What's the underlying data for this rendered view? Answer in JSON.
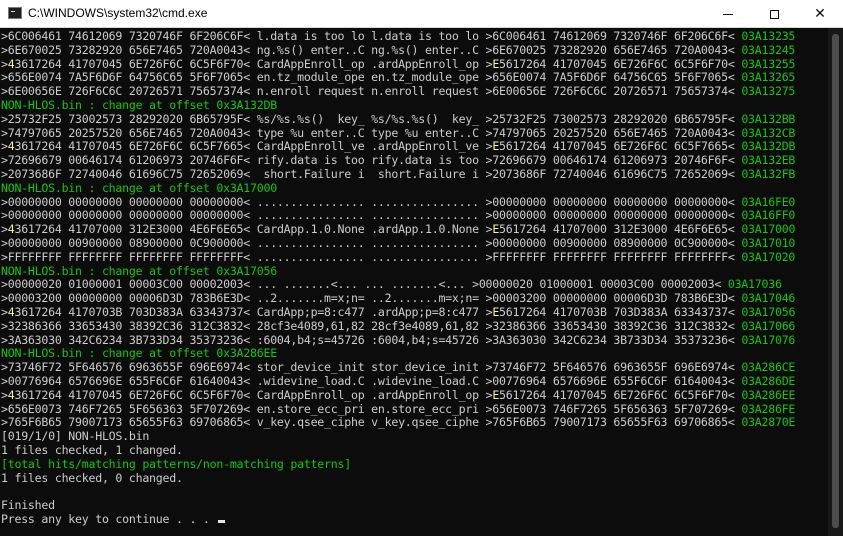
{
  "window": {
    "title": "C:\\WINDOWS\\system32\\cmd.exe",
    "icon": "cmd-icon",
    "controls": [
      "minimize-icon",
      "maximize-icon",
      "close-icon"
    ]
  },
  "colors": {
    "background": "#0c0c0c",
    "text": "#cccccc",
    "accent": "#16c60c",
    "highlight": "#f9f1a5"
  },
  "console": {
    "lines": [
      {
        "color": "gray",
        "text": ">6C006461 74612069 7320746F 6F206C6F< l.data is too lo l.data is too lo >6C006461 74612069 7320746F 6F206C6F< ",
        "addr": "03A13235"
      },
      {
        "color": "gray",
        "text": ">6E670025 73282920 656E7465 720A0043< ng.%s() enter..C ng.%s() enter..C >6E670025 73282920 656E7465 720A0043< ",
        "addr": "03A13245"
      },
      {
        "color": "gray",
        "pre": ">",
        "hl": "4",
        "text": "3617264 41707045 6E726F6C 6C5F6F70< CardAppEnroll_op .ardAppEnroll_op >",
        "hl2": "E",
        "post": "5617264 41707045 6E726F6C 6C5F6F70< ",
        "addr": "03A13255"
      },
      {
        "color": "gray",
        "text": ">656E0074 7A5F6D6F 64756C65 5F6F7065< en.tz_module_ope en.tz_module_ope >656E0074 7A5F6D6F 64756C65 5F6F7065< ",
        "addr": "03A13265"
      },
      {
        "color": "gray",
        "text": ">6E00656E 726F6C6C 20726571 75657374< n.enroll request n.enroll request >6E00656E 726F6C6C 20726571 75657374< ",
        "addr": "03A13275"
      },
      {
        "color": "green",
        "text": "NON-HLOS.bin : change at offset 0x3A132DB"
      },
      {
        "color": "gray",
        "text": ">25732F25 73002573 28292020 6B65795F< %s/%s.%s()  key_ %s/%s.%s()  key_ >25732F25 73002573 28292020 6B65795F< ",
        "addr": "03A132BB"
      },
      {
        "color": "gray",
        "text": ">74797065 20257520 656E7465 720A0043< type %u enter..C type %u enter..C >74797065 20257520 656E7465 720A0043< ",
        "addr": "03A132CB"
      },
      {
        "color": "gray",
        "pre": ">",
        "hl": "4",
        "text": "3617264 41707045 6E726F6C 6C5F7665< CardAppEnroll_ve .ardAppEnroll_ve >",
        "hl2": "E",
        "post": "5617264 41707045 6E726F6C 6C5F7665< ",
        "addr": "03A132DB"
      },
      {
        "color": "gray",
        "text": ">72696679 00646174 61206973 20746F6F< rify.data is too rify.data is too >72696679 00646174 61206973 20746F6F< ",
        "addr": "03A132EB"
      },
      {
        "color": "gray",
        "text": ">2073686F 72740046 61696C75 72652069<  short.Failure i  short.Failure i >2073686F 72740046 61696C75 72652069< ",
        "addr": "03A132FB"
      },
      {
        "color": "green",
        "text": "NON-HLOS.bin : change at offset 0x3A17000"
      },
      {
        "color": "gray",
        "text": ">00000000 00000000 00000000 00000000< ................ ................ >00000000 00000000 00000000 00000000< ",
        "addr": "03A16FE0"
      },
      {
        "color": "gray",
        "text": ">00000000 00000000 00000000 00000000< ................ ................ >00000000 00000000 00000000 00000000< ",
        "addr": "03A16FF0"
      },
      {
        "color": "gray",
        "pre": ">",
        "hl": "4",
        "text": "3617264 41707000 312E3000 4E6F6E65< CardApp.1.0.None .ardApp.1.0.None >",
        "hl2": "E",
        "post": "5617264 41707000 312E3000 4E6F6E65< ",
        "addr": "03A17000"
      },
      {
        "color": "gray",
        "text": ">00000000 00900000 08900000 0C900000< ................ ................ >00000000 00900000 08900000 0C900000< ",
        "addr": "03A17010"
      },
      {
        "color": "gray",
        "text": ">FFFFFFFF FFFFFFFF FFFFFFFF FFFFFFFF< ................ ................ >FFFFFFFF FFFFFFFF FFFFFFFF FFFFFFFF< ",
        "addr": "03A17020"
      },
      {
        "color": "green",
        "text": "NON-HLOS.bin : change at offset 0x3A17056"
      },
      {
        "color": "gray",
        "text": ">00000020 01000001 00003C00 00002003< ... .......<... ... .......<... >00000020 01000001 00003C00 00002003< ",
        "addr": "03A17036"
      },
      {
        "color": "gray",
        "text": ">00003200 00000000 00006D3D 783B6E3D< ..2.......m=x;n= ..2.......m=x;n= >00003200 00000000 00006D3D 783B6E3D< ",
        "addr": "03A17046"
      },
      {
        "color": "gray",
        "pre": ">",
        "hl": "4",
        "text": "3617264 4170703B 703D383A 63343737< CardApp;p=8:c477 .ardApp;p=8:c477 >",
        "hl2": "E",
        "post": "5617264 4170703B 703D383A 63343737< ",
        "addr": "03A17056"
      },
      {
        "color": "gray",
        "text": ">32386366 33653430 38392C36 312C3832< 28cf3e4089,61,82 28cf3e4089,61,82 >32386366 33653430 38392C36 312C3832< ",
        "addr": "03A17066"
      },
      {
        "color": "gray",
        "text": ">3A363030 342C6234 3B733D34 35373236< :6004,b4;s=45726 :6004,b4;s=45726 >3A363030 342C6234 3B733D34 35373236< ",
        "addr": "03A17076"
      },
      {
        "color": "green",
        "text": "NON-HLOS.bin : change at offset 0x3A286EE"
      },
      {
        "color": "gray",
        "text": ">73746F72 5F646576 6963655F 696E6974< stor_device_init stor_device_init >73746F72 5F646576 6963655F 696E6974< ",
        "addr": "03A286CE"
      },
      {
        "color": "gray",
        "text": ">00776964 6576696E 655F6C6F 61640043< .widevine_load.C .widevine_load.C >00776964 6576696E 655F6C6F 61640043< ",
        "addr": "03A286DE"
      },
      {
        "color": "gray",
        "pre": ">",
        "hl": "4",
        "text": "3617264 41707045 6E726F6C 6C5F6F70< CardAppEnroll_op .ardAppEnroll_op >",
        "hl2": "E",
        "post": "5617264 41707045 6E726F6C 6C5F6F70< ",
        "addr": "03A286EE"
      },
      {
        "color": "gray",
        "text": ">656E0073 746F7265 5F656363 5F707269< en.store_ecc_pri en.store_ecc_pri >656E0073 746F7265 5F656363 5F707269< ",
        "addr": "03A286FE"
      },
      {
        "color": "gray",
        "text": ">765F6B65 79007173 65655F63 69706865< v_key.qsee_ciphe v_key.qsee_ciphe >765F6B65 79007173 65655F63 69706865< ",
        "addr": "03A2870E"
      },
      {
        "color": "gray",
        "text": "[019/1/0] NON-HLOS.bin"
      },
      {
        "color": "gray",
        "text": "1 files checked, 1 changed."
      },
      {
        "color": "green",
        "text": "[total hits/matching patterns/non-matching patterns]"
      },
      {
        "color": "gray",
        "text": "1 files checked, 0 changed."
      },
      {
        "color": "gray",
        "text": ""
      },
      {
        "color": "gray",
        "text": "Finished"
      },
      {
        "color": "gray",
        "text": "Press any key to continue . . . ",
        "cursor": true
      }
    ]
  }
}
